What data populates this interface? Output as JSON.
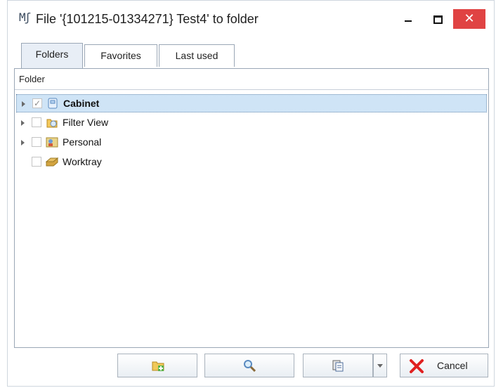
{
  "window": {
    "app_icon": "Mʃ",
    "title": "File '{101215-01334271} Test4' to folder",
    "controls": {
      "minimize": "minimize-icon",
      "maximize": "maximize-icon",
      "close": "✕"
    }
  },
  "tabs": [
    {
      "label": "Folders",
      "active": true
    },
    {
      "label": "Favorites",
      "active": false
    },
    {
      "label": "Last used",
      "active": false
    }
  ],
  "tree": {
    "column_header": "Folder",
    "items": [
      {
        "label": "Cabinet",
        "checked": true,
        "expandable": true,
        "selected": true,
        "icon": "cabinet-icon",
        "check_mark": "✓"
      },
      {
        "label": "Filter View",
        "checked": false,
        "expandable": true,
        "selected": false,
        "icon": "filter-view-icon"
      },
      {
        "label": "Personal",
        "checked": false,
        "expandable": true,
        "selected": false,
        "icon": "personal-icon"
      },
      {
        "label": "Worktray",
        "checked": false,
        "expandable": false,
        "selected": false,
        "icon": "worktray-icon"
      }
    ]
  },
  "footer": {
    "new_folder_icon": "new-folder-icon",
    "search_icon": "search-icon",
    "paste_icon": "paste-icon",
    "cancel_label": "Cancel",
    "colors": {
      "close": "#e04343",
      "selection": "#cfe4f6",
      "cancel_x": "#e02020"
    }
  }
}
